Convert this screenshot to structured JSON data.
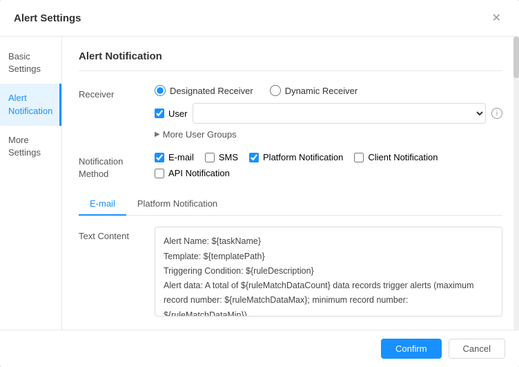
{
  "dialog": {
    "title": "Alert Settings",
    "close_label": "✕"
  },
  "sidebar": {
    "items": [
      {
        "id": "basic-settings",
        "label": "Basic Settings",
        "active": false
      },
      {
        "id": "alert-notification",
        "label": "Alert Notification",
        "active": true
      },
      {
        "id": "more-settings",
        "label": "More Settings",
        "active": false
      }
    ]
  },
  "main": {
    "section_title": "Alert Notification",
    "receiver": {
      "label": "Receiver",
      "options": [
        {
          "id": "designated",
          "label": "Designated Receiver",
          "checked": true
        },
        {
          "id": "dynamic",
          "label": "Dynamic Receiver",
          "checked": false
        }
      ]
    },
    "user": {
      "checkbox_label": "User",
      "checked": true,
      "placeholder": ""
    },
    "more_groups": {
      "label": "More User Groups"
    },
    "notification_method": {
      "label": "Notification Method",
      "options": [
        {
          "id": "email",
          "label": "E-mail",
          "checked": true
        },
        {
          "id": "sms",
          "label": "SMS",
          "checked": false
        },
        {
          "id": "platform",
          "label": "Platform Notification",
          "checked": true
        },
        {
          "id": "client",
          "label": "Client Notification",
          "checked": false
        },
        {
          "id": "api",
          "label": "API Notification",
          "checked": false
        }
      ]
    },
    "tabs": [
      {
        "id": "email-tab",
        "label": "E-mail",
        "active": true
      },
      {
        "id": "platform-tab",
        "label": "Platform Notification",
        "active": false
      }
    ],
    "text_content": {
      "label": "Text Content",
      "value": "Alert Name: ${taskName}\nTemplate: ${templatePath}\nTriggering Condition: ${ruleDescription}\nAlert data: A total of ${ruleMatchDataCount} data records trigger alerts (maximum record number: ${ruleMatchDataMax}; minimum record number: ${ruleMatchDataMin})."
    }
  },
  "footer": {
    "confirm_label": "Confirm",
    "cancel_label": "Cancel"
  }
}
